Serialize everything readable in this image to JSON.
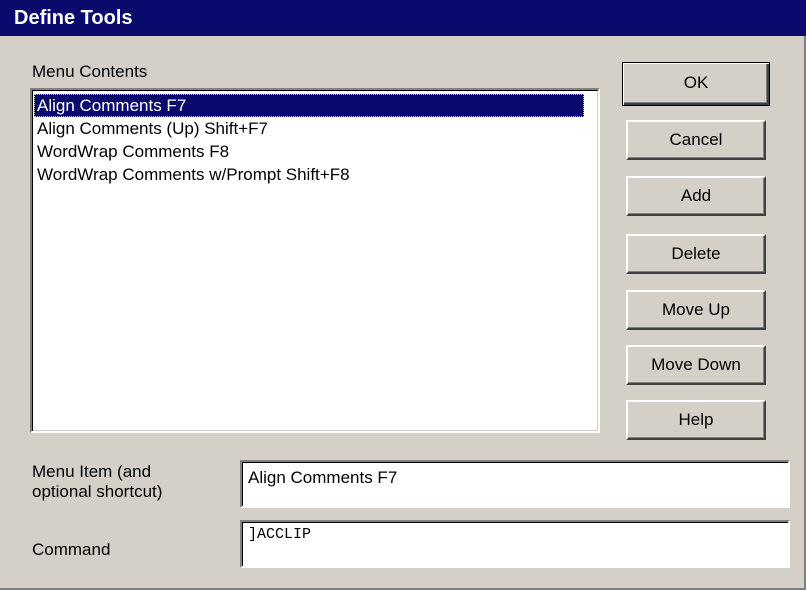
{
  "window": {
    "title": "Define Tools"
  },
  "menu_contents": {
    "label": "Menu Contents",
    "items": [
      {
        "label": "Align Comments F7",
        "selected": true
      },
      {
        "label": "Align Comments (Up) Shift+F7",
        "selected": false
      },
      {
        "label": "WordWrap Comments F8",
        "selected": false
      },
      {
        "label": "WordWrap Comments w/Prompt Shift+F8",
        "selected": false
      }
    ]
  },
  "buttons": {
    "ok": "OK",
    "cancel": "Cancel",
    "add": "Add",
    "delete": "Delete",
    "move_up": "Move Up",
    "move_down": "Move Down",
    "help": "Help"
  },
  "menu_item_field": {
    "label_line1": "Menu Item (and",
    "label_line2": "optional shortcut)",
    "value": "Align Comments F7"
  },
  "command_field": {
    "label": "Command",
    "value": "]ACCLIP"
  },
  "colors": {
    "title_bar": "#0a0a6c",
    "selection": "#0a0a6c",
    "dialog_face": "#d4d0c8"
  }
}
